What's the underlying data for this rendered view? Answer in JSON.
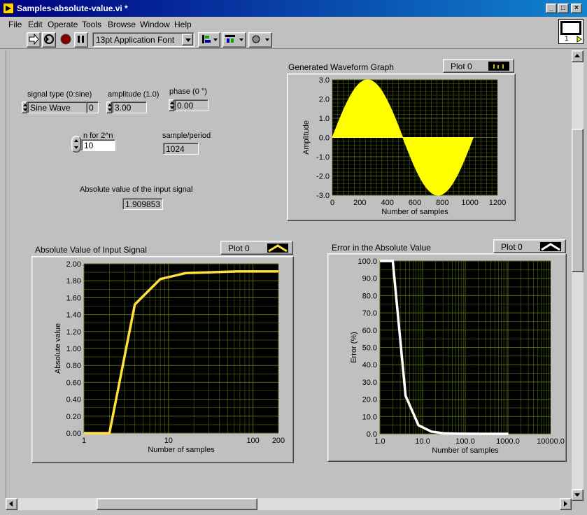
{
  "window": {
    "title": "Samples-absolute-value.vi *"
  },
  "menu": [
    "File",
    "Edit",
    "Operate",
    "Tools",
    "Browse",
    "Window",
    "Help"
  ],
  "toolbar": {
    "font": "13pt Application Font"
  },
  "vi_icon": {
    "label": "1"
  },
  "controls": {
    "signal_type": {
      "label": "signal type (0:sine)",
      "value": "Sine Wave",
      "index": "0"
    },
    "amplitude": {
      "label": "amplitude (1.0)",
      "value": "3.00"
    },
    "phase": {
      "label": "phase (0 °)",
      "value": "0.00"
    },
    "n": {
      "label": "n for 2^n",
      "value": "10"
    },
    "sample_period": {
      "label": "sample/period",
      "value": "1024"
    },
    "abs_value": {
      "label": "Absolute value of the input signal",
      "value": "1.909853"
    }
  },
  "colors": {
    "panel": "#c0c0c0",
    "plot_bg": "#000000",
    "grid": "#506a10",
    "yellow": "#ffff00",
    "gold": "#ffe040",
    "white": "#ffffff"
  },
  "chart_data": [
    {
      "type": "area",
      "title": "Generated Waveform Graph",
      "legend": "Plot 0",
      "xlabel": "Number of samples",
      "ylabel": "Amplitude",
      "xlim": [
        0,
        1200
      ],
      "ylim": [
        -3.0,
        3.0
      ],
      "xticks": [
        "0",
        "200",
        "400",
        "600",
        "800",
        "1000",
        "1200"
      ],
      "yticks": [
        "3.0",
        "2.0",
        "1.0",
        "0.0",
        "-1.0",
        "-2.0",
        "-3.0"
      ],
      "series": [
        {
          "amplitude": 3.0,
          "samples": 1024,
          "periods": 1,
          "color": "#ffff00"
        }
      ]
    },
    {
      "type": "line",
      "title": "Absolute Value of Input Signal",
      "legend": "Plot 0",
      "xlabel": "Number of samples",
      "ylabel": "Absolute value",
      "xscale": "log",
      "xlim": [
        1,
        200
      ],
      "ylim": [
        0,
        2.0
      ],
      "xticks": [
        "1",
        "10",
        "100",
        "200"
      ],
      "yticks": [
        "2.00",
        "1.80",
        "1.60",
        "1.40",
        "1.20",
        "1.00",
        "0.80",
        "0.60",
        "0.40",
        "0.20",
        "0.00"
      ],
      "series": [
        {
          "x": [
            1,
            2,
            4,
            8,
            16,
            32,
            64,
            128,
            200
          ],
          "y": [
            0,
            0,
            1.52,
            1.82,
            1.89,
            1.9,
            1.91,
            1.91,
            1.91
          ],
          "color": "#ffe040"
        }
      ]
    },
    {
      "type": "line",
      "title": "Error in the Absolute Value",
      "legend": "Plot 0",
      "xlabel": "Number of samples",
      "ylabel": "Error (%)",
      "xscale": "log",
      "xlim": [
        1.0,
        10000.0
      ],
      "ylim": [
        0,
        100.0
      ],
      "xticks": [
        "1.0",
        "10.0",
        "100.0",
        "1000.0",
        "10000.0"
      ],
      "yticks": [
        "100.0",
        "90.0",
        "80.0",
        "70.0",
        "60.0",
        "50.0",
        "40.0",
        "30.0",
        "20.0",
        "10.0",
        "0.0"
      ],
      "series": [
        {
          "x": [
            1,
            2,
            4,
            8,
            16,
            32,
            64,
            128,
            256,
            512,
            1024
          ],
          "y": [
            100,
            100,
            22,
            5,
            1.3,
            0.3,
            0.1,
            0.05,
            0.01,
            0.01,
            0
          ],
          "color": "#ffffff"
        }
      ]
    }
  ]
}
